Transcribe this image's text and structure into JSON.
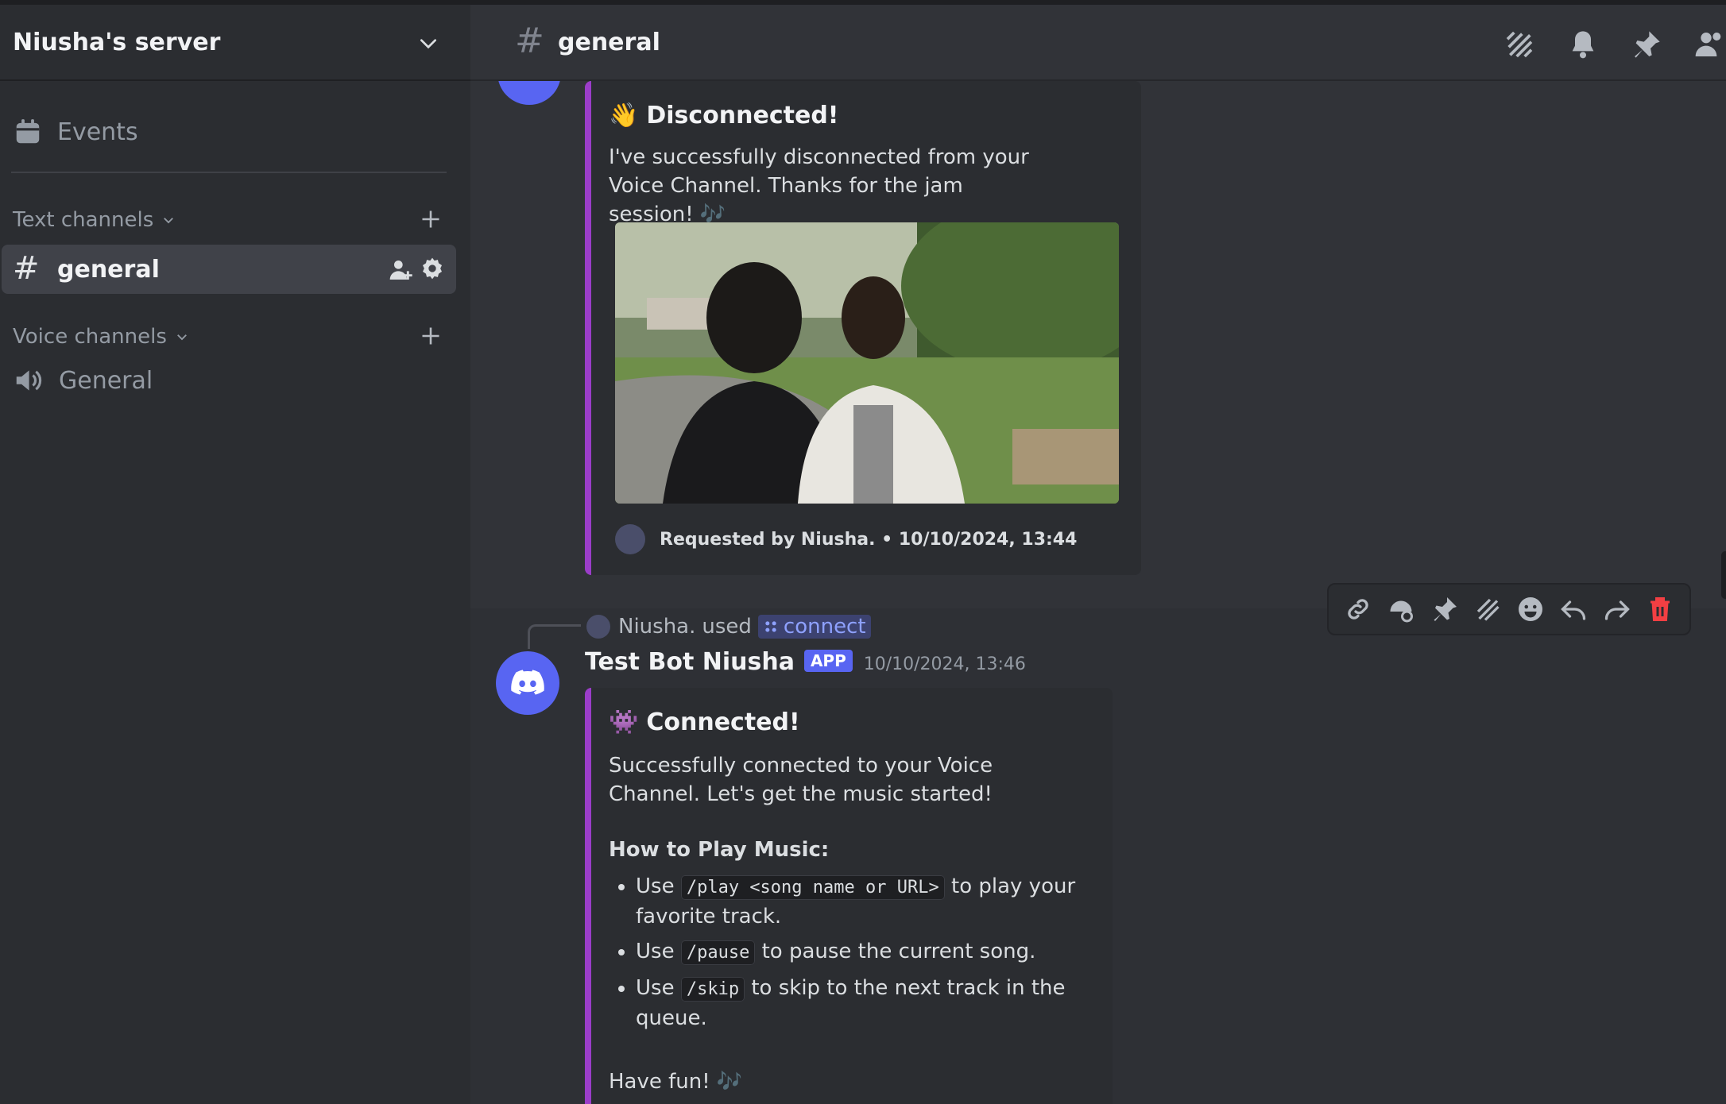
{
  "server": {
    "name": "Niusha's server"
  },
  "sidebar": {
    "events_label": "Events",
    "text_category": "Text channels",
    "voice_category": "Voice channels",
    "text_channels": [
      {
        "name": "general"
      }
    ],
    "voice_channels": [
      {
        "name": "General"
      }
    ]
  },
  "channel_header": {
    "name": "general"
  },
  "messages": {
    "embed1": {
      "emoji": "👋",
      "title": "Disconnected!",
      "text": "I've successfully disconnected from your Voice Channel. Thanks for the jam session! 🎶",
      "footer": "Requested by Niusha. • 10/10/2024, 13:44"
    },
    "message2": {
      "reply_user": "Niusha.",
      "reply_used": "used",
      "reply_command": "connect",
      "author": "Test Bot Niusha",
      "badge": "APP",
      "timestamp": "10/10/2024, 13:46",
      "embed": {
        "emoji": "👾",
        "title": "Connected!",
        "intro": "Successfully connected to your Voice Channel. Let's get the music started!",
        "howto_title": "How to Play Music:",
        "items": [
          {
            "pre": "Use",
            "code": "/play <song name or URL>",
            "post": "to play your favorite track."
          },
          {
            "pre": "Use",
            "code": "/pause",
            "post": "to pause the current song."
          },
          {
            "pre": "Use",
            "code": "/skip",
            "post": "to skip to the next track in the queue."
          }
        ],
        "outro": "Have fun! 🎶"
      }
    }
  },
  "colors": {
    "accent": "#5865f2",
    "embed_border": "#9b3dc9",
    "delete": "#f23f43",
    "link": "#8ea1ff"
  }
}
